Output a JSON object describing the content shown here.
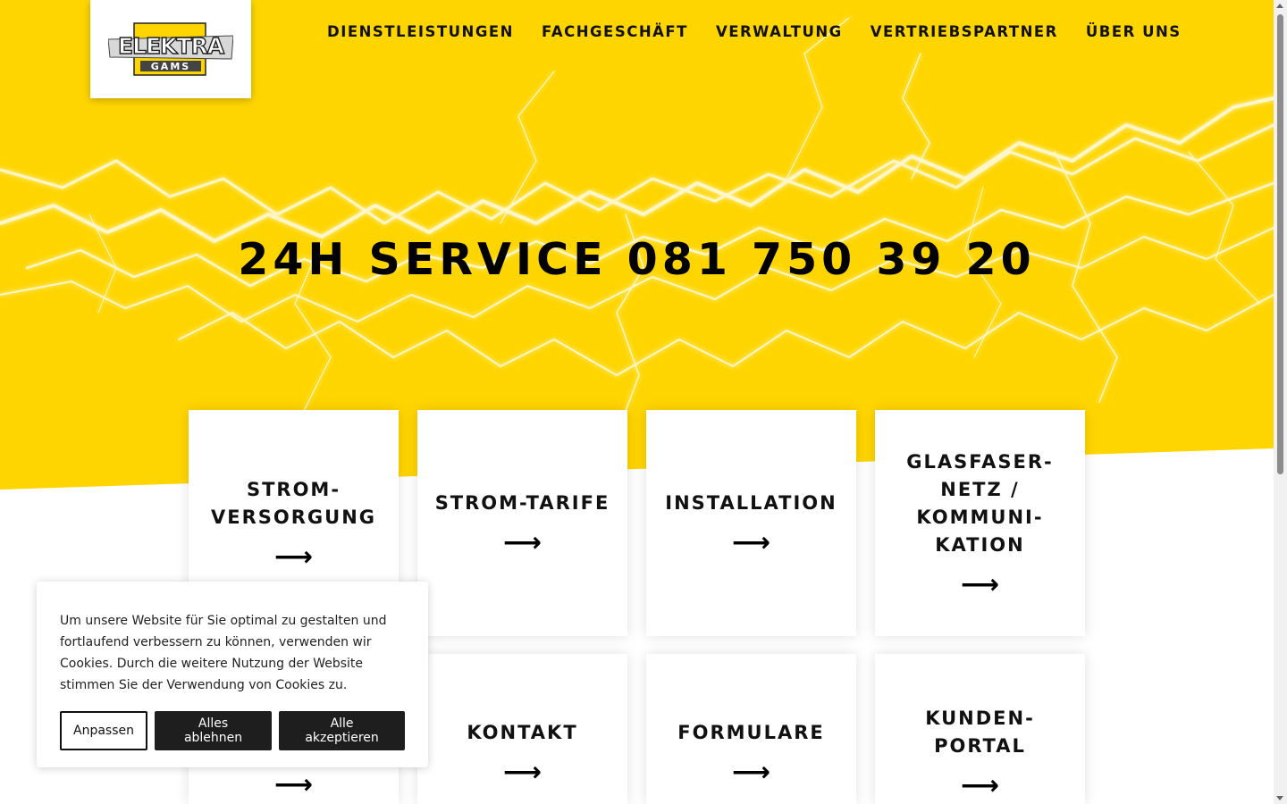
{
  "colors": {
    "brand_yellow": "#ffd500",
    "text_dark": "#111111",
    "button_dark": "#1e1e1e"
  },
  "logo": {
    "line1": "ELEKTRA",
    "line2": "GAMS"
  },
  "nav": {
    "items": [
      "DIENSTLEISTUNGEN",
      "FACHGESCHÄFT",
      "VERWALTUNG",
      "VERTRIEBSPARTNER",
      "ÜBER UNS"
    ]
  },
  "hero": {
    "title": "24H SERVICE 081 750 39 20"
  },
  "tiles": [
    {
      "label": "STROM-\nVERSORGUNG",
      "icon": "arrow-right-icon"
    },
    {
      "label": "STROM-TARIFE",
      "icon": "arrow-right-icon"
    },
    {
      "label": "INSTALLATION",
      "icon": "arrow-right-icon"
    },
    {
      "label": "GLASFASER-\nNETZ /\nKOMMUNI-\nKATION",
      "icon": "arrow-right-icon"
    },
    {
      "label": "",
      "icon": "arrow-right-icon"
    },
    {
      "label": "KONTAKT",
      "icon": "arrow-right-icon"
    },
    {
      "label": "FORMULARE",
      "icon": "arrow-right-icon"
    },
    {
      "label": "KUNDEN-\nPORTAL",
      "icon": "arrow-right-icon"
    }
  ],
  "cookie_banner": {
    "text": "Um unsere Website für Sie optimal zu gestalten und fortlaufend verbessern zu können, verwenden wir Cookies. Durch die weitere Nutzung der Website stimmen Sie der Verwendung von Cookies zu.",
    "customize_label": "Anpassen",
    "reject_label": "Alles ablehnen",
    "accept_label": "Alle akzeptieren"
  }
}
